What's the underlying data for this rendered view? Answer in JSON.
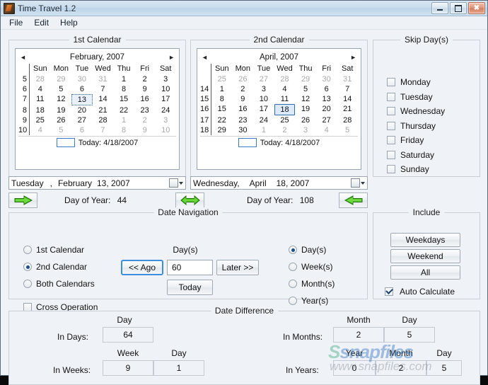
{
  "window": {
    "title": "Time Travel 1.2",
    "icon": "app-icon",
    "buttons": {
      "minimize": "—",
      "maximize": "□",
      "close": "✕"
    }
  },
  "menu": {
    "items": [
      "File",
      "Edit",
      "Help"
    ]
  },
  "calendar1": {
    "group_title": "1st Calendar",
    "prev_arrow": "◄",
    "next_arrow": "►",
    "month_label": "February, 2007",
    "day_headers": [
      "Sun",
      "Mon",
      "Tue",
      "Wed",
      "Thu",
      "Fri",
      "Sat"
    ],
    "week_numbers": [
      "5",
      "6",
      "7",
      "8",
      "9",
      "10"
    ],
    "weeks": [
      [
        {
          "d": "28",
          "o": true
        },
        {
          "d": "29",
          "o": true
        },
        {
          "d": "30",
          "o": true
        },
        {
          "d": "31",
          "o": true
        },
        {
          "d": "1"
        },
        {
          "d": "2"
        },
        {
          "d": "3"
        }
      ],
      [
        {
          "d": "4"
        },
        {
          "d": "5"
        },
        {
          "d": "6"
        },
        {
          "d": "7"
        },
        {
          "d": "8"
        },
        {
          "d": "9"
        },
        {
          "d": "10"
        }
      ],
      [
        {
          "d": "11"
        },
        {
          "d": "12"
        },
        {
          "d": "13",
          "sel": "dot"
        },
        {
          "d": "14"
        },
        {
          "d": "15"
        },
        {
          "d": "16"
        },
        {
          "d": "17"
        }
      ],
      [
        {
          "d": "18"
        },
        {
          "d": "19"
        },
        {
          "d": "20"
        },
        {
          "d": "21"
        },
        {
          "d": "22"
        },
        {
          "d": "23"
        },
        {
          "d": "24"
        }
      ],
      [
        {
          "d": "25"
        },
        {
          "d": "26"
        },
        {
          "d": "27"
        },
        {
          "d": "28"
        },
        {
          "d": "1",
          "o": true
        },
        {
          "d": "2",
          "o": true
        },
        {
          "d": "3",
          "o": true
        }
      ],
      [
        {
          "d": "4",
          "o": true
        },
        {
          "d": "5",
          "o": true
        },
        {
          "d": "6",
          "o": true
        },
        {
          "d": "7",
          "o": true
        },
        {
          "d": "8",
          "o": true
        },
        {
          "d": "9",
          "o": true
        },
        {
          "d": "10",
          "o": true
        }
      ]
    ],
    "today_label": "Today: 4/18/2007",
    "field": {
      "weekday": "Tuesday",
      "comma": ",",
      "month": "February",
      "day_year": "13, 2007"
    },
    "day_of_year_label": "Day of Year:",
    "day_of_year_value": "44"
  },
  "calendar2": {
    "group_title": "2nd Calendar",
    "prev_arrow": "◄",
    "next_arrow": "►",
    "month_label": "April, 2007",
    "day_headers": [
      "Sun",
      "Mon",
      "Tue",
      "Wed",
      "Thu",
      "Fri",
      "Sat"
    ],
    "week_numbers": [
      "",
      "14",
      "15",
      "16",
      "17",
      "18"
    ],
    "weeks": [
      [
        {
          "d": "25",
          "o": true
        },
        {
          "d": "26",
          "o": true
        },
        {
          "d": "27",
          "o": true
        },
        {
          "d": "28",
          "o": true
        },
        {
          "d": "29",
          "o": true
        },
        {
          "d": "30",
          "o": true
        },
        {
          "d": "31",
          "o": true
        }
      ],
      [
        {
          "d": "1"
        },
        {
          "d": "2"
        },
        {
          "d": "3"
        },
        {
          "d": "4"
        },
        {
          "d": "5"
        },
        {
          "d": "6"
        },
        {
          "d": "7"
        }
      ],
      [
        {
          "d": "8"
        },
        {
          "d": "9"
        },
        {
          "d": "10"
        },
        {
          "d": "11"
        },
        {
          "d": "12"
        },
        {
          "d": "13"
        },
        {
          "d": "14"
        }
      ],
      [
        {
          "d": "15"
        },
        {
          "d": "16"
        },
        {
          "d": "17"
        },
        {
          "d": "18",
          "sel": "box"
        },
        {
          "d": "19"
        },
        {
          "d": "20"
        },
        {
          "d": "21"
        }
      ],
      [
        {
          "d": "22"
        },
        {
          "d": "23"
        },
        {
          "d": "24"
        },
        {
          "d": "25"
        },
        {
          "d": "26"
        },
        {
          "d": "27"
        },
        {
          "d": "28"
        }
      ],
      [
        {
          "d": "29"
        },
        {
          "d": "30"
        },
        {
          "d": "1",
          "o": true
        },
        {
          "d": "2",
          "o": true
        },
        {
          "d": "3",
          "o": true
        },
        {
          "d": "4",
          "o": true
        },
        {
          "d": "5",
          "o": true
        }
      ]
    ],
    "today_label": "Today: 4/18/2007",
    "field": {
      "weekday": "Wednesday,",
      "comma": "",
      "month": "April",
      "day_year": "18, 2007"
    },
    "day_of_year_label": "Day of Year:",
    "day_of_year_value": "108"
  },
  "skip_days": {
    "group_title": "Skip Day(s)",
    "items": [
      {
        "label": "Monday",
        "checked": false
      },
      {
        "label": "Tuesday",
        "checked": false
      },
      {
        "label": "Wednesday",
        "checked": false
      },
      {
        "label": "Thursday",
        "checked": false
      },
      {
        "label": "Friday",
        "checked": false
      },
      {
        "label": "Saturday",
        "checked": false
      },
      {
        "label": "Sunday",
        "checked": false
      }
    ]
  },
  "date_navigation": {
    "group_title": "Date Navigation",
    "target_options": [
      {
        "label": "1st Calendar",
        "checked": false
      },
      {
        "label": "2nd Calendar",
        "checked": true
      },
      {
        "label": "Both Calendars",
        "checked": false
      }
    ],
    "cross_operation": {
      "label": "Cross Operation",
      "checked": false
    },
    "amount_label": "Day(s)",
    "amount_value": "60",
    "ago_button": "<< Ago",
    "later_button": "Later >>",
    "today_button": "Today",
    "unit_options": [
      {
        "label": "Day(s)",
        "checked": true
      },
      {
        "label": "Week(s)",
        "checked": false
      },
      {
        "label": "Month(s)",
        "checked": false
      },
      {
        "label": "Year(s)",
        "checked": false
      }
    ]
  },
  "include": {
    "group_title": "Include",
    "buttons": [
      "Weekdays",
      "Weekend",
      "All"
    ],
    "auto_calculate": {
      "label": "Auto Calculate",
      "checked": true
    }
  },
  "date_difference": {
    "group_title": "Date Difference",
    "in_days": {
      "row_label": "In Days:",
      "headers": [
        "Day"
      ],
      "values": [
        "64"
      ]
    },
    "in_weeks": {
      "row_label": "In Weeks:",
      "headers": [
        "Week",
        "Day"
      ],
      "values": [
        "9",
        "1"
      ]
    },
    "in_months": {
      "row_label": "In Months:",
      "headers": [
        "Month",
        "Day"
      ],
      "values": [
        "2",
        "5"
      ]
    },
    "in_years": {
      "row_label": "In Years:",
      "headers": [
        "Year",
        "Month",
        "Day"
      ],
      "values": [
        "0",
        "2",
        "5"
      ]
    }
  },
  "watermark": {
    "logo_prefix": "S",
    "logo": "snapfiles",
    "url": "www.snapfiles.com"
  }
}
